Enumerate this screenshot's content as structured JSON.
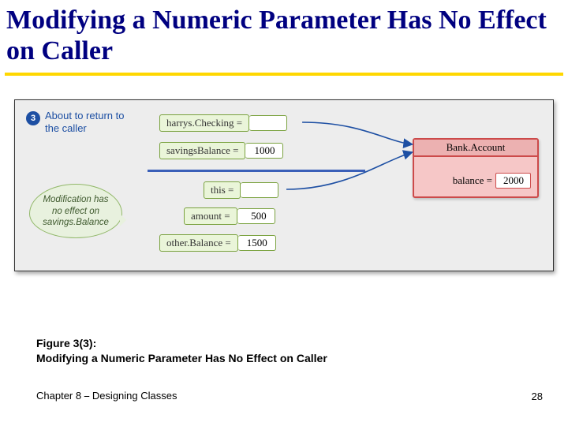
{
  "title": "Modifying a Numeric Parameter Has No Effect on Caller",
  "step": {
    "number": "3",
    "label": "About to return to the caller"
  },
  "vars": {
    "harrysChecking": {
      "name": "harrys.Checking =",
      "value": ""
    },
    "savingsBalance": {
      "name": "savingsBalance =",
      "value": "1000"
    },
    "this": {
      "name": "this =",
      "value": ""
    },
    "amount": {
      "name": "amount =",
      "value": "500"
    },
    "otherBalance": {
      "name": "other.Balance =",
      "value": "1500"
    }
  },
  "object": {
    "title": "Bank.Account",
    "field_name": "balance =",
    "field_value": "2000"
  },
  "bubble": "Modification has no effect on savings.Balance",
  "caption_line1": "Figure 3(3):",
  "caption_line2": "Modifying a Numeric Parameter Has No Effect on Caller",
  "footer_left": "Chapter 8 ⎯ Designing Classes",
  "footer_right": "28"
}
